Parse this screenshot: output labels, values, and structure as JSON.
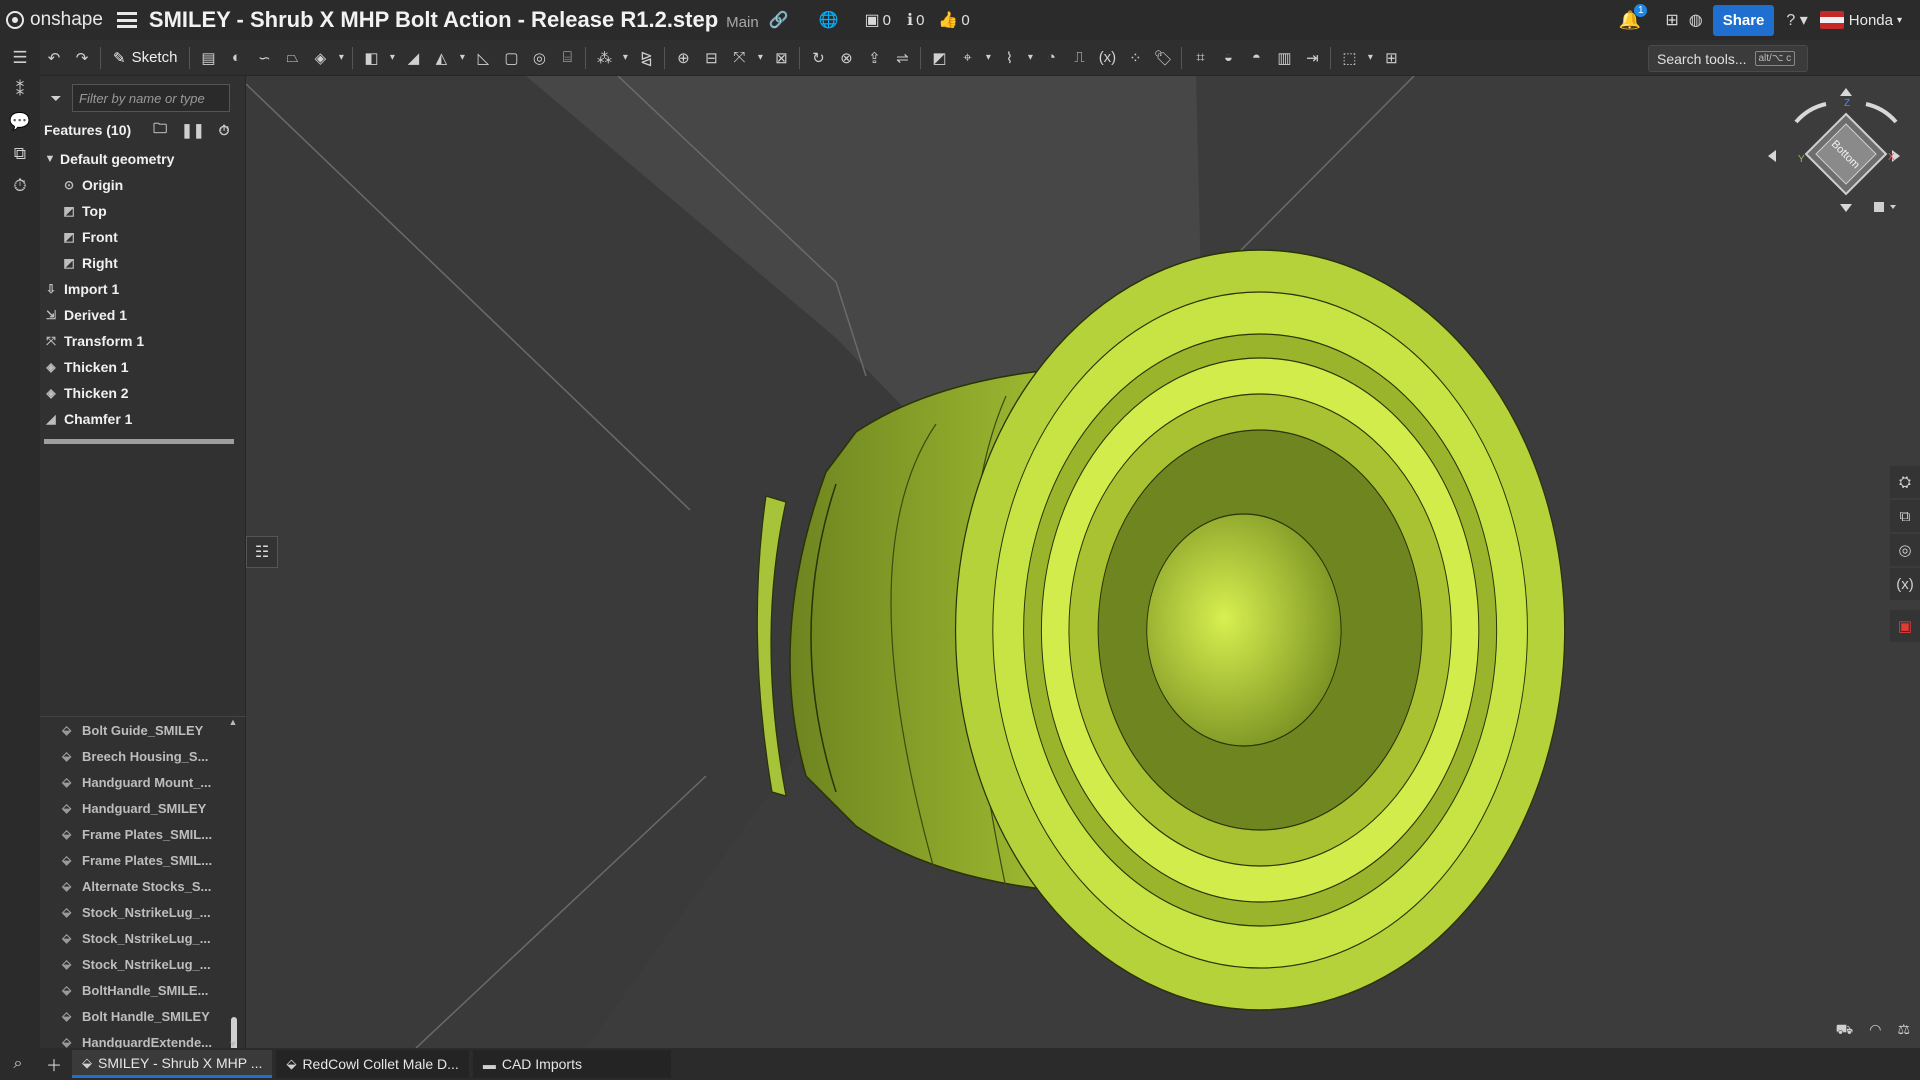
{
  "header": {
    "logo_text": "onshape",
    "doc_title": "SMILEY - Shrub X MHP Bolt Action - Release R1.2.step",
    "branch": "Main",
    "versions_count": "0",
    "info_count": "0",
    "likes_count": "0",
    "notification_count": "1",
    "share_label": "Share",
    "user_name": "Honda"
  },
  "toolbar": {
    "sketch_label": "Sketch",
    "search_label": "Search tools...",
    "search_shortcut": "alt/⌥ c"
  },
  "feature_panel": {
    "filter_placeholder": "Filter by name or type",
    "features_label": "Features (10)",
    "default_geometry": "Default geometry",
    "geometry_items": [
      "Origin",
      "Top",
      "Front",
      "Right"
    ],
    "features": [
      "Import 1",
      "Derived 1",
      "Transform 1",
      "Thicken 1",
      "Thicken 2",
      "Chamfer 1"
    ]
  },
  "parts": [
    "Bolt Guide_SMILEY",
    "Breech Housing_S...",
    "Handguard Mount_...",
    "Handguard_SMILEY",
    "Frame Plates_SMIL...",
    "Frame Plates_SMIL...",
    "Alternate Stocks_S...",
    "Stock_NstrikeLug_...",
    "Stock_NstrikeLug_...",
    "Stock_NstrikeLug_...",
    "BoltHandle_SMILE...",
    "Bolt Handle_SMILEY",
    "HandguardExtende..."
  ],
  "viewcube": {
    "face_label": "Bottom",
    "axis_x": "X",
    "axis_y": "Y",
    "axis_z": "Z"
  },
  "tabs": [
    {
      "label": "SMILEY - Shrub X MHP ...",
      "active": true
    },
    {
      "label": "RedCowl Collet Male D...",
      "active": false
    },
    {
      "label": "CAD Imports",
      "active": false
    }
  ],
  "colors": {
    "part_light": "#d4ec4a",
    "part_mid": "#a6c232",
    "part_dark": "#5f731a",
    "accent": "#1f6fd1"
  }
}
